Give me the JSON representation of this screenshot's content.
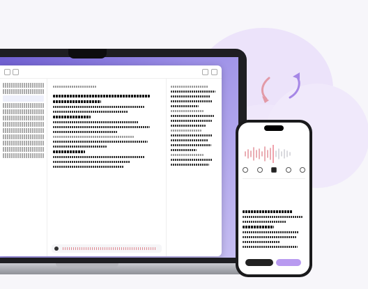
{
  "laptop": {
    "app": {
      "window_title": "",
      "document_title": "",
      "sidebar_items": [
        "",
        "",
        "",
        "",
        "",
        "",
        "",
        "",
        "",
        ""
      ],
      "player": {
        "speed": "",
        "time": ""
      }
    }
  },
  "phone": {
    "status_time": "",
    "doc_title": "",
    "buttons": {
      "primary": "",
      "secondary": ""
    }
  },
  "colors": {
    "accent": "#9b8ee6",
    "wave": "#e08a93",
    "phone_button": "#b89af0",
    "sync_arrow": "#a687e6"
  },
  "icons": [
    "sync-icon",
    "play-icon",
    "mic-icon",
    "gear-icon"
  ]
}
